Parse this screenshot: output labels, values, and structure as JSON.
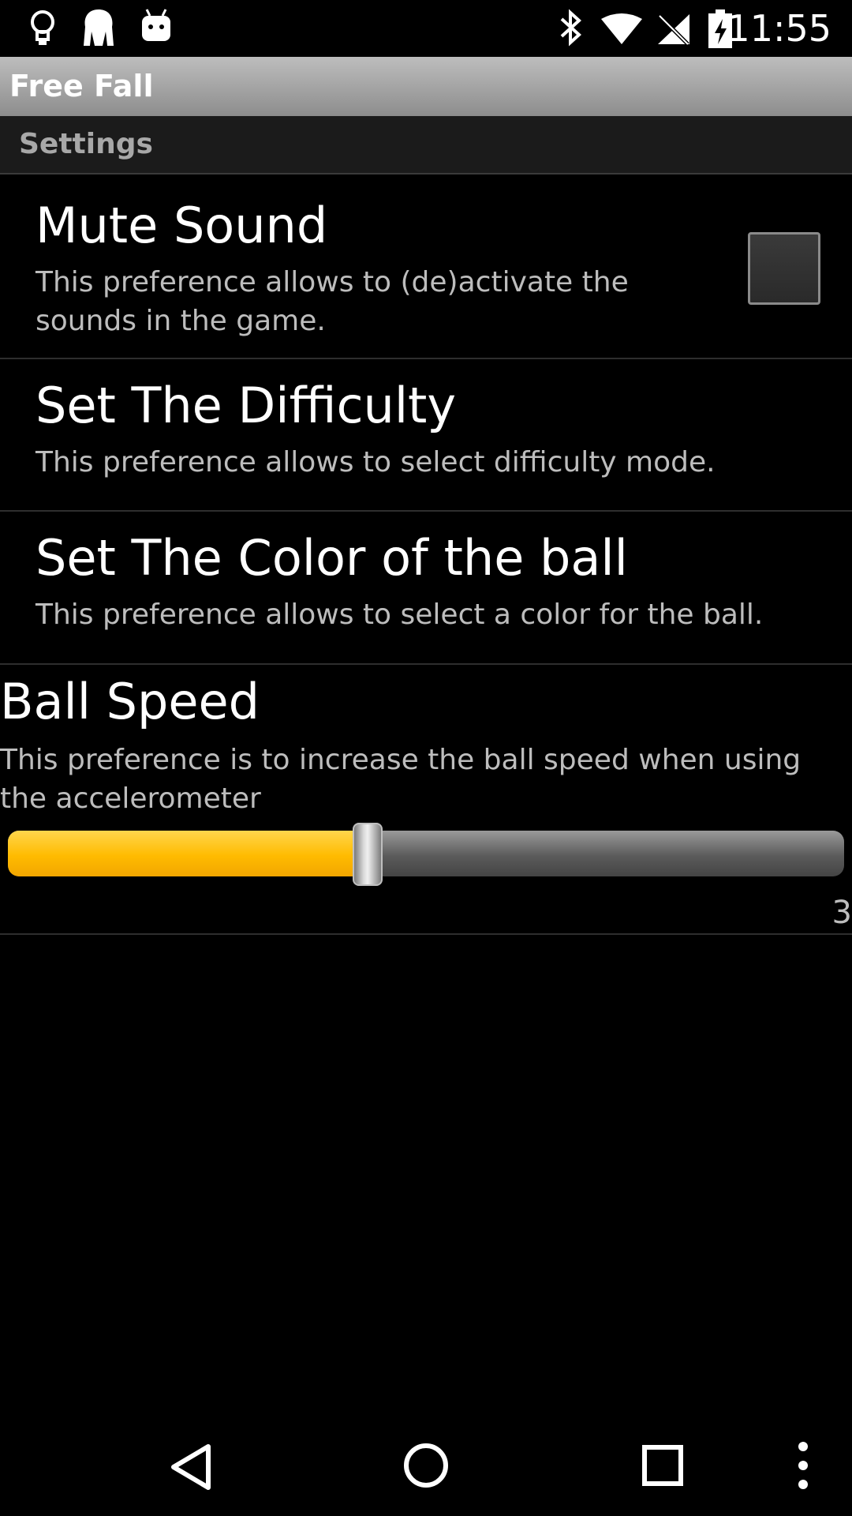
{
  "status_bar": {
    "time": "11:55",
    "left_icons": [
      "lightbulb-icon",
      "app-notification-icon",
      "android-icon"
    ],
    "right_icons": [
      "bluetooth-icon",
      "wifi-icon",
      "no-signal-icon",
      "battery-charging-icon"
    ]
  },
  "app": {
    "title": "Free Fall"
  },
  "settings": {
    "category": "Settings",
    "mute_sound": {
      "title": "Mute Sound",
      "summary_line1": "This preference allows to (de)activate the",
      "summary_line2": "sounds in the game.",
      "checked": false
    },
    "difficulty": {
      "title": "Set The Difficulty",
      "summary": "This preference allows to select difficulty mode."
    },
    "ball_color": {
      "title": "Set The Color of the ball",
      "summary": "This preference allows to select a color for the ball."
    },
    "ball_speed": {
      "title": "Ball Speed",
      "summary_line1": "This preference is to increase the ball speed when using",
      "summary_line2": "the accelerometer",
      "value_label": "3",
      "level_fraction": 0.43
    }
  },
  "nav_bar": {
    "icons": [
      "back-icon",
      "home-icon",
      "recents-icon",
      "overflow-menu-icon"
    ]
  },
  "colors": {
    "slider_accent": "#ffbb00",
    "title_bar": "#a5a5a5",
    "background": "#000000"
  }
}
